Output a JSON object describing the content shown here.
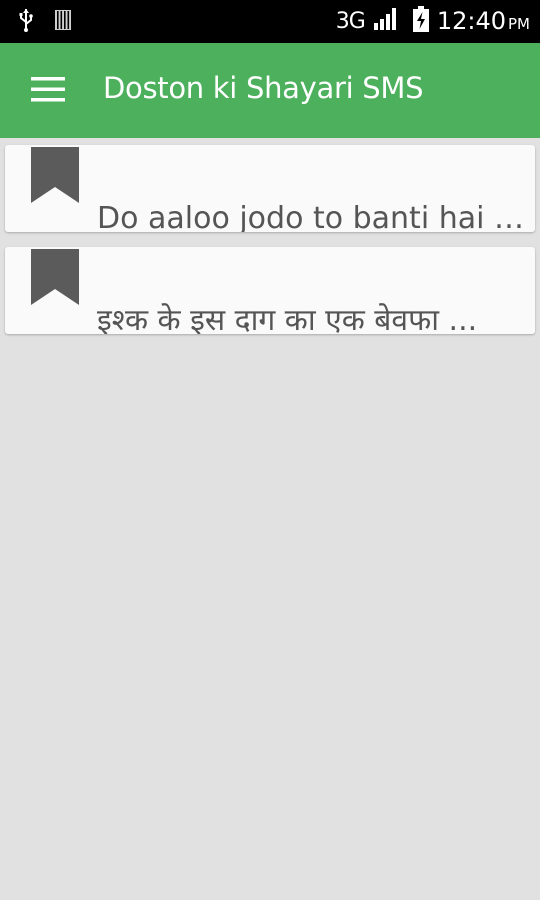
{
  "status_bar": {
    "icons_left": [
      "usb-icon",
      "sd-card-icon"
    ],
    "network": "3G",
    "icons_right": [
      "signal-icon",
      "battery-charging-icon"
    ],
    "time": "12:40",
    "ampm": "PM"
  },
  "app_bar": {
    "menu_icon": "hamburger-menu-icon",
    "title": "Doston ki Shayari SMS",
    "color": "#4cb05c"
  },
  "list": {
    "items": [
      {
        "icon": "bookmark-icon",
        "text": "Do aaloo jodo to banti hai aaloo ki jodi"
      },
      {
        "icon": "bookmark-icon",
        "text": "इश्क के इस दाग का एक बेवफा ..."
      }
    ]
  }
}
